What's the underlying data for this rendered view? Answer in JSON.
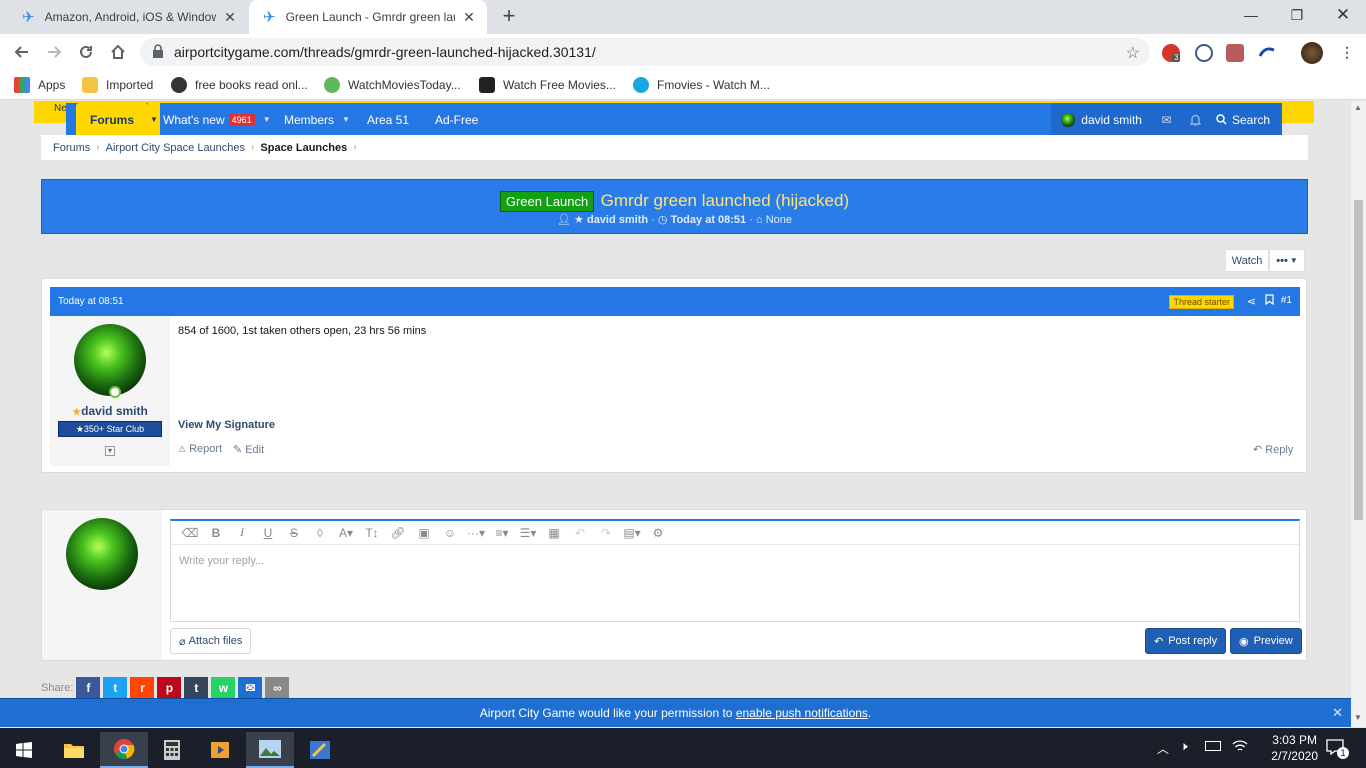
{
  "browser": {
    "tabs": [
      {
        "title": "Amazon, Android, iOS & Window"
      },
      {
        "title": "Green Launch - Gmrdr green lau"
      }
    ],
    "url": "airportcitygame.com/threads/gmrdr-green-launched-hijacked.30131/",
    "ext_badge": "3",
    "bookmarks": [
      {
        "label": "Apps"
      },
      {
        "label": "Imported"
      },
      {
        "label": "free books read onl..."
      },
      {
        "label": "WatchMoviesToday..."
      },
      {
        "label": "Watch Free Movies..."
      },
      {
        "label": "Fmovies - Watch M..."
      }
    ]
  },
  "site": {
    "nav": {
      "forums": "Forums",
      "whats_new": "What's new",
      "whats_new_count": "4961",
      "members": "Members",
      "area51": "Area 51",
      "adfree": "Ad-Free",
      "username": "david smith",
      "search": "Search"
    },
    "yellow_prefix": "Ne",
    "breadcrumb": [
      "Forums",
      "Airport City Space Launches",
      "Space Launches"
    ],
    "thread": {
      "prefix": "Green Launch",
      "title": "Gmrdr green launched (hijacked)",
      "author": "david smith",
      "date": "Today at 08:51",
      "tags": "None"
    },
    "watch_label": "Watch",
    "more_label": "•••",
    "post": {
      "date": "Today at 08:51",
      "starter_badge": "Thread starter",
      "number": "#1",
      "username": "david smith",
      "user_title": "350+ Star Club",
      "body": "854 of 1600, 1st taken others open, 23 hrs 56 mins",
      "signature": "View My Signature",
      "report": "Report",
      "edit": "Edit",
      "reply": "Reply"
    },
    "reply": {
      "placeholder": "Write your reply...",
      "attach": "Attach files",
      "post_reply": "Post reply",
      "preview": "Preview"
    },
    "share_label": "Share:",
    "push": {
      "text": "Airport City Game would like your permission to",
      "link": "enable push notifications",
      "suffix": "."
    }
  },
  "taskbar": {
    "time": "3:03 PM",
    "date": "2/7/2020",
    "notif_count": "1"
  },
  "colors": {
    "navbar": "#2577e3",
    "accent_yellow": "#ffd700",
    "prefix_green": "#14a014",
    "title_yellow": "#ffe27a",
    "button_blue": "#1f5fb4"
  }
}
